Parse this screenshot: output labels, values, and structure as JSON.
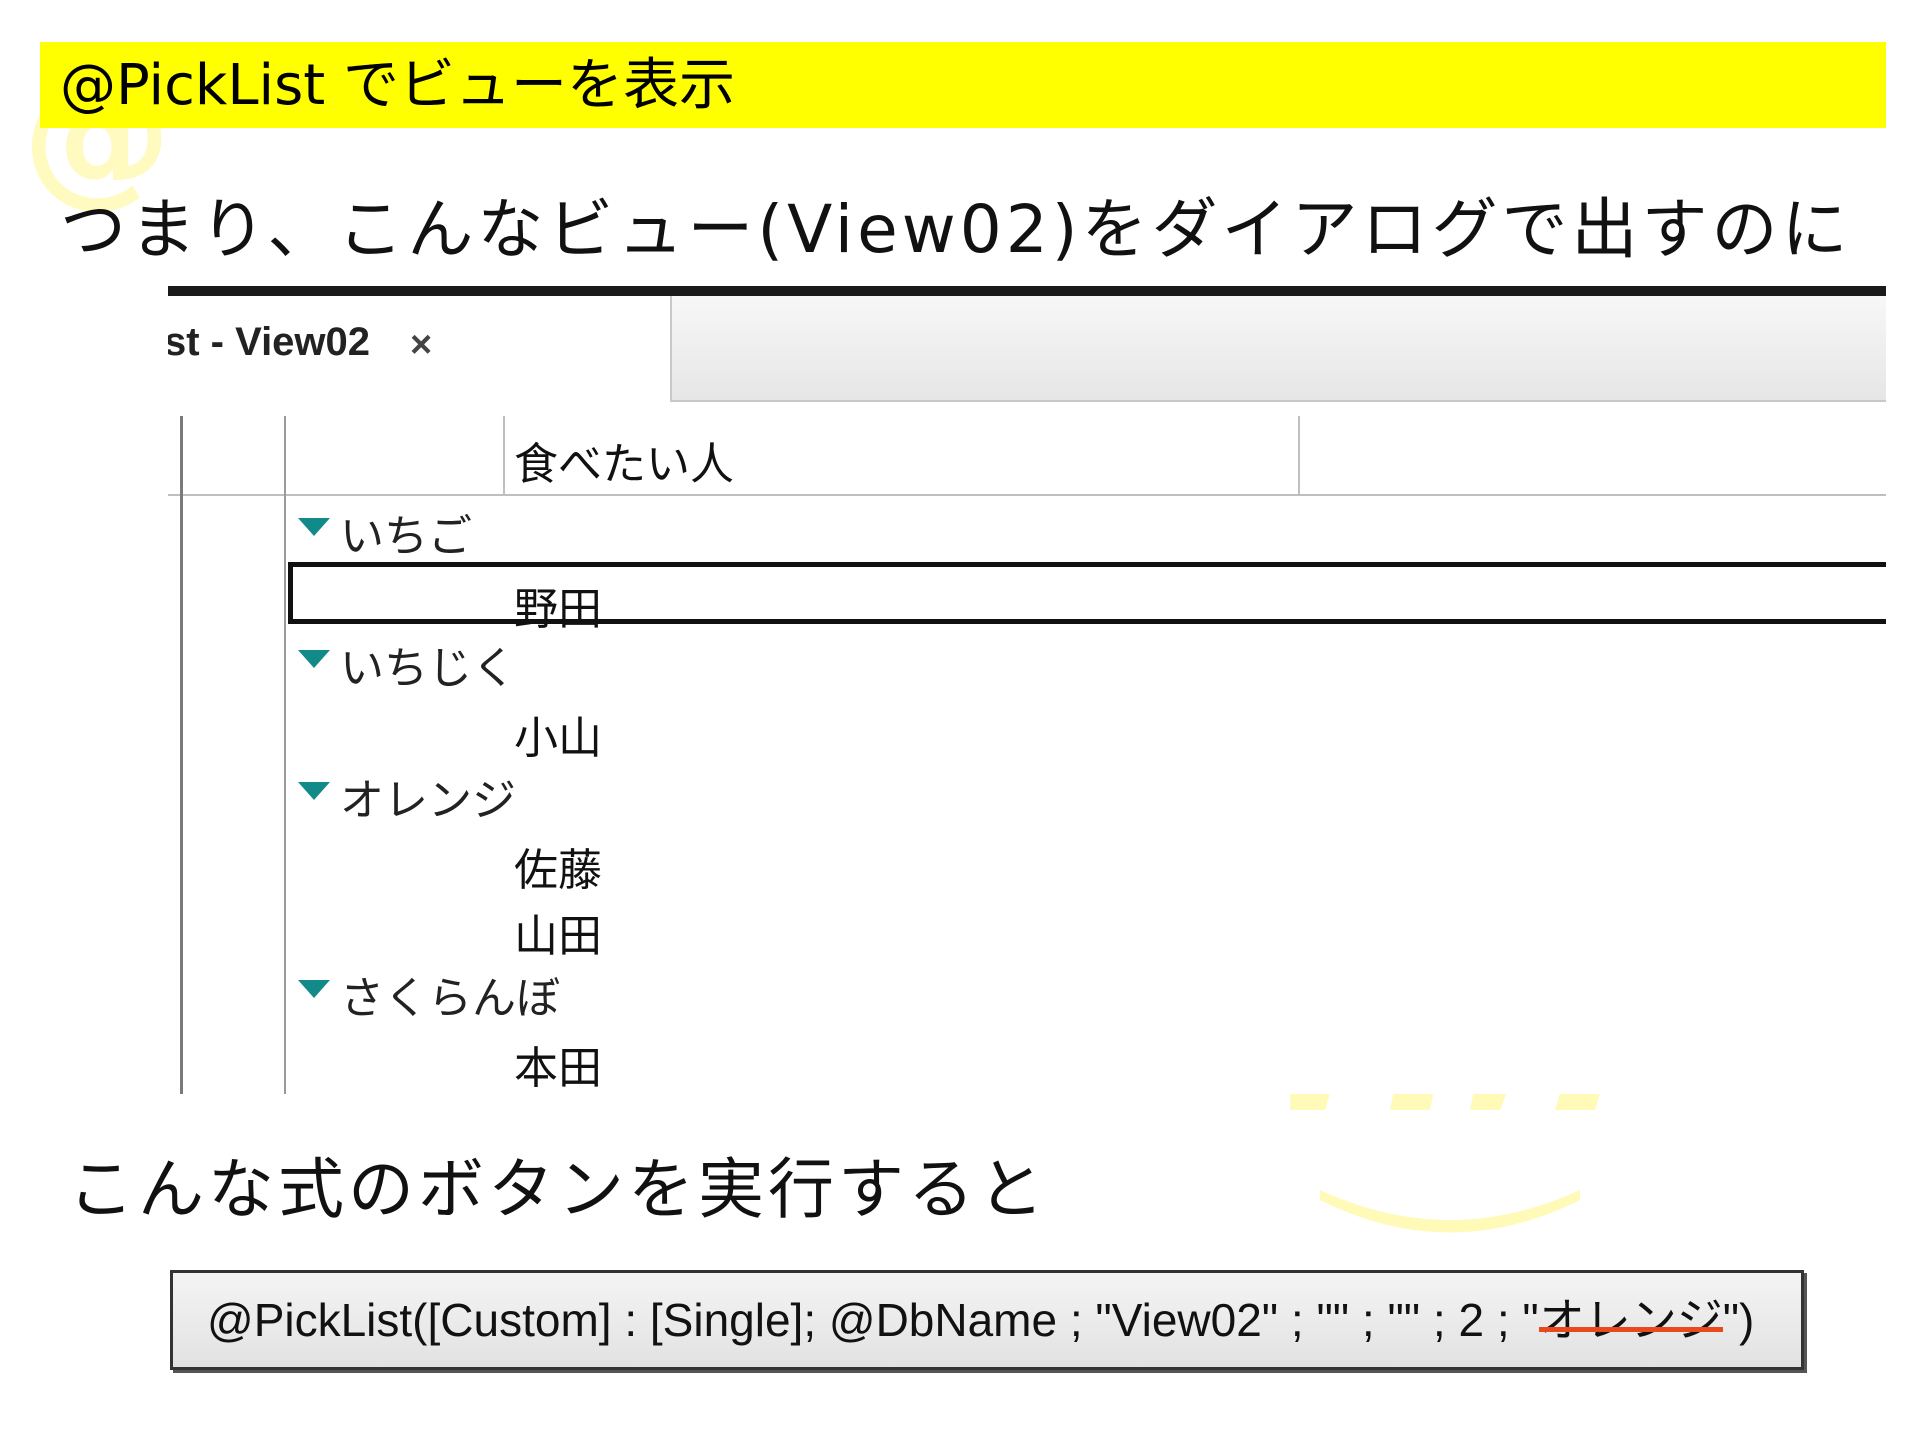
{
  "slide": {
    "title": "@PickList でビューを表示",
    "caption_top": "つまり、こんなビュー(View02)をダイアログで出すのに",
    "caption_bottom": "こんな式のボタンを実行すると"
  },
  "view_window": {
    "tab_label": "st - View02",
    "tab_close_glyph": "×",
    "column_header": "食べたい人",
    "rows": [
      {
        "type": "category",
        "label": "いちご"
      },
      {
        "type": "document",
        "label": "野田",
        "selected": true
      },
      {
        "type": "category",
        "label": "いちじく"
      },
      {
        "type": "document",
        "label": "小山"
      },
      {
        "type": "category",
        "label": "オレンジ"
      },
      {
        "type": "document",
        "label": "佐藤"
      },
      {
        "type": "document",
        "label": "山田"
      },
      {
        "type": "category",
        "label": "さくらんぼ"
      },
      {
        "type": "document",
        "label": "本田"
      }
    ],
    "twisty_color": "#128a8a"
  },
  "formula_button": {
    "text_before": "@PickList([Custom] : [Single]; @DbName ; \"View02\" ; \"\" ; \"\" ; 2 ; \"",
    "highlighted": "オレンジ",
    "text_after": "\")",
    "underline_color": "#e8491d"
  },
  "colors": {
    "title_bar": "#ffff00",
    "watermark": "#fffac0"
  }
}
